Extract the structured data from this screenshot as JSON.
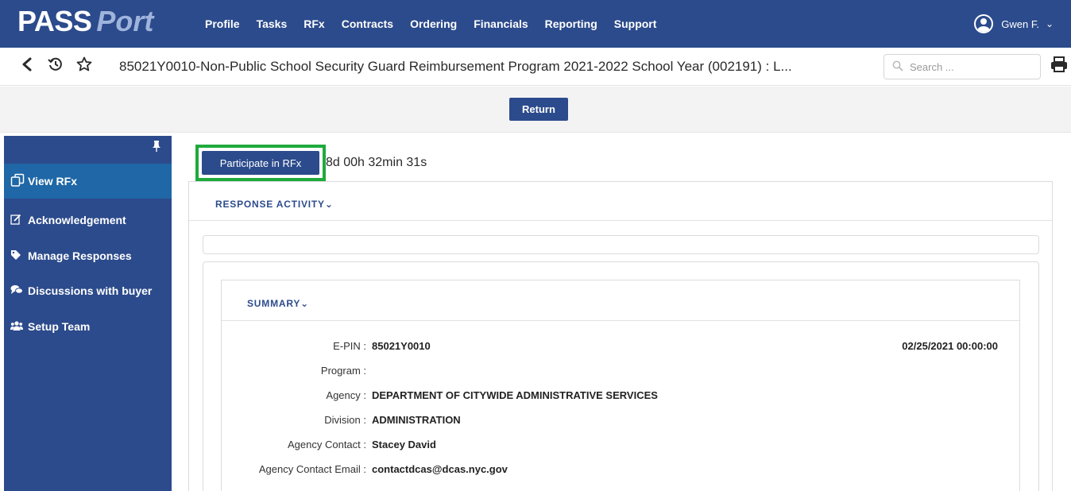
{
  "header": {
    "logo_pass": "PASS",
    "logo_port": "Port",
    "menu": [
      "Profile",
      "Tasks",
      "RFx",
      "Contracts",
      "Ordering",
      "Financials",
      "Reporting",
      "Support"
    ],
    "user_name": "Gwen F.",
    "user_chevron": "⌄"
  },
  "titlebar": {
    "title": "85021Y0010-Non-Public School Security Guard Reimbursement Program 2021-2022 School Year (002191) : L...",
    "search_placeholder": "Search ...",
    "icons": [
      "back-icon",
      "history-icon",
      "star-icon",
      "search-icon",
      "print-icon"
    ]
  },
  "actions": {
    "return_label": "Return",
    "participate_label": "Participate in RFx",
    "countdown": "8d 00h 32min 31s"
  },
  "sidebar": {
    "items": [
      {
        "label": "View RFx",
        "icon": "copy-icon"
      },
      {
        "label": "Acknowledgement",
        "icon": "edit-icon"
      },
      {
        "label": "Manage Responses",
        "icon": "tag-icon"
      },
      {
        "label": "Discussions with buyer",
        "icon": "comments-icon"
      },
      {
        "label": "Setup Team",
        "icon": "users-icon"
      }
    ]
  },
  "response_activity": {
    "title": "RESPONSE ACTIVITY",
    "chevron": "⌄"
  },
  "summary": {
    "title": "SUMMARY",
    "chevron": "⌄",
    "date": "02/25/2021 00:00:00",
    "fields": [
      {
        "label": "E-PIN :",
        "value": "85021Y0010"
      },
      {
        "label": "Program :",
        "value": ""
      },
      {
        "label": "Agency :",
        "value": "DEPARTMENT OF CITYWIDE ADMINISTRATIVE SERVICES"
      },
      {
        "label": "Division :",
        "value": "ADMINISTRATION"
      },
      {
        "label": "Agency Contact :",
        "value": "Stacey David"
      },
      {
        "label": "Agency Contact Email :",
        "value": "contactdcas@dcas.nyc.gov"
      }
    ]
  },
  "colors": {
    "brand_blue": "#2c4b8c",
    "active_blue": "#1f67a6",
    "highlight_green": "#1faa3c"
  }
}
